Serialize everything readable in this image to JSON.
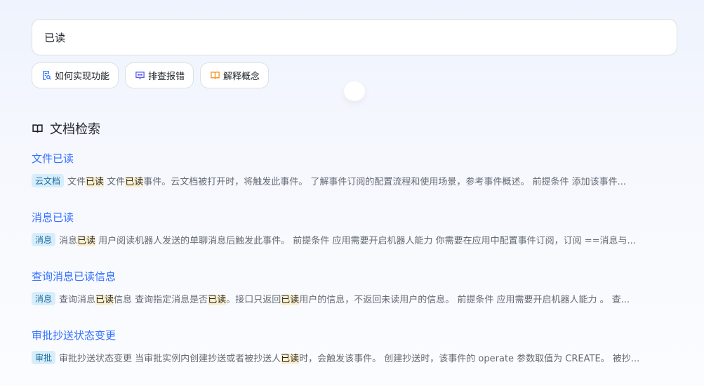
{
  "search": {
    "value": "已读"
  },
  "chips": [
    {
      "label": "如何实现功能",
      "icon": "doc-search-icon",
      "color": "#3370ff"
    },
    {
      "label": "排查报错",
      "icon": "chat-bubble-icon",
      "color": "#5b5bf0"
    },
    {
      "label": "解释概念",
      "icon": "book-icon",
      "color": "#f5911e"
    }
  ],
  "section": {
    "title": "文档检索"
  },
  "results": [
    {
      "title": "文件已读",
      "tag": "云文档",
      "snippet": [
        {
          "t": "文件"
        },
        {
          "t": "已读",
          "hl": true
        },
        {
          "t": " 文件"
        },
        {
          "t": "已读",
          "hl": true
        },
        {
          "t": "事件。云文档被打开时，将触发此事件。 了解事件订阅的配置流程和使用场景，参考事件概述。 前提条件 添加该事件..."
        }
      ]
    },
    {
      "title": "消息已读",
      "tag": "消息",
      "snippet": [
        {
          "t": "消息"
        },
        {
          "t": "已读",
          "hl": true
        },
        {
          "t": " 用户阅读机器人发送的单聊消息后触发此事件。 前提条件 应用需要开启机器人能力 你需要在应用中配置事件订阅，订阅 ==消息与..."
        }
      ]
    },
    {
      "title": "查询消息已读信息",
      "tag": "消息",
      "snippet": [
        {
          "t": "查询消息"
        },
        {
          "t": "已读",
          "hl": true
        },
        {
          "t": "信息 查询指定消息是否"
        },
        {
          "t": "已读",
          "hl": true
        },
        {
          "t": "。接口只返回"
        },
        {
          "t": "已读",
          "hl": true
        },
        {
          "t": "用户的信息，不返回未读用户的信息。 前提条件 应用需要开启机器人能力 。 查..."
        }
      ]
    },
    {
      "title": "审批抄送状态变更",
      "tag": "审批",
      "snippet": [
        {
          "t": "审批抄送状态变更 当审批实例内创建抄送或者被抄送人"
        },
        {
          "t": "已读",
          "hl": true
        },
        {
          "t": "时，会触发该事件。 创建抄送时，该事件的 operate 参数取值为 CREATE。 被抄..."
        }
      ]
    }
  ]
}
